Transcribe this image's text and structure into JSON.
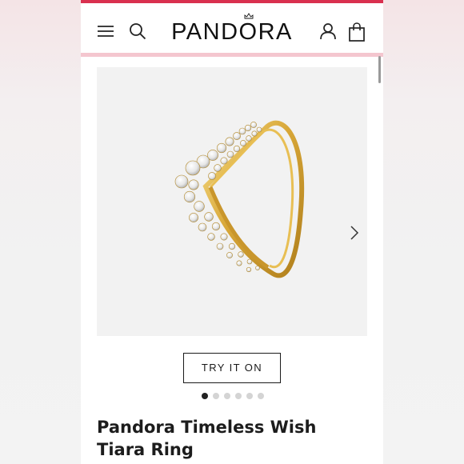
{
  "brand": {
    "logo_text": "PANDORA",
    "accent_color": "#d9304f",
    "header_rule_color": "#f4c6cf"
  },
  "header": {
    "menu_icon": "hamburger-menu-icon",
    "search_icon": "search-icon",
    "account_icon": "user-account-icon",
    "bag_icon": "shopping-bag-icon",
    "logo_icon": "crown-icon"
  },
  "gallery": {
    "image_subject": "gold-tiara-ring",
    "next_icon": "chevron-right-icon",
    "image_count": 6,
    "active_index": 0
  },
  "actions": {
    "try_on_label": "TRY IT ON"
  },
  "product": {
    "title": "Pandora Timeless Wish Tiara Ring"
  }
}
